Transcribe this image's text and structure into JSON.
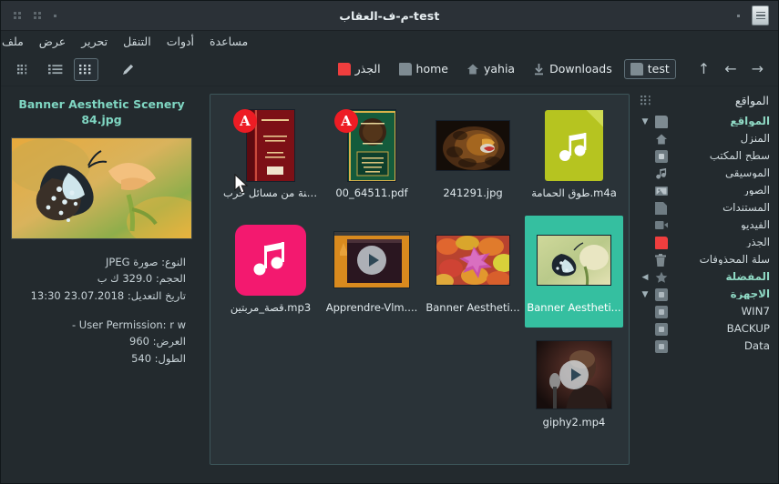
{
  "window": {
    "title": "م-ف-العقاب-test",
    "app_icon": "document-app-icon"
  },
  "menubar": {
    "items": [
      {
        "label": "ملف"
      },
      {
        "label": "عرض"
      },
      {
        "label": "تحرير"
      },
      {
        "label": "التنقل"
      },
      {
        "label": "أدوات"
      },
      {
        "label": "مساعدة"
      }
    ]
  },
  "toolbar": {
    "view_buttons": [
      {
        "name": "compact-view-button",
        "icon": "compact-view-icon"
      },
      {
        "name": "list-view-button",
        "icon": "list-view-icon"
      },
      {
        "name": "icon-view-button",
        "icon": "grid-view-icon",
        "active": true
      }
    ],
    "edit_button": {
      "name": "edit-button",
      "icon": "pencil-icon"
    },
    "nav": {
      "up": "↑",
      "back": "←",
      "forward": "→"
    },
    "breadcrumb": [
      {
        "label": "test",
        "icon": "folder-icon",
        "current": true
      },
      {
        "label": "Downloads",
        "icon": "download-icon",
        "current": false
      },
      {
        "label": "yahia",
        "icon": "home-icon",
        "current": false
      },
      {
        "label": "home",
        "icon": "folder-icon",
        "current": false
      },
      {
        "label": "الجذر",
        "icon": "root-folder-icon",
        "current": false
      }
    ]
  },
  "preview": {
    "title": "Banner Aesthetic Scenery 84.jpg",
    "thumbnail_alt": "butterfly-on-flower-photo",
    "metadata": [
      {
        "text": "النوع: صورة JPEG",
        "rtl": true
      },
      {
        "text": "الحجم: 329.0 ك ب",
        "rtl": true
      },
      {
        "text": "تاريخ التعديل: 23.07.2018 13:30",
        "rtl": true
      },
      {
        "text": "-  User Permission: r  w",
        "rtl": false
      },
      {
        "text": "العرض: 960",
        "rtl": true
      },
      {
        "text": "الطول: 540",
        "rtl": true
      }
    ]
  },
  "files": [
    {
      "label": "طوق الحمامة.m4a",
      "kind": "audio-document",
      "selected": false
    },
    {
      "label": "241291.jpg",
      "kind": "image-lion",
      "selected": false
    },
    {
      "label": "00_64511.pdf",
      "kind": "pdf-green-book",
      "selected": false
    },
    {
      "label": "السنة من مسائل حرب...",
      "kind": "pdf-red-book",
      "selected": false
    },
    {
      "label": "Banner Aestheti...",
      "kind": "image-butterfly",
      "selected": true
    },
    {
      "label": "Banner Aestheti...",
      "kind": "image-leaves",
      "selected": false
    },
    {
      "label": "Apprendre-Vlm....",
      "kind": "video-orange",
      "selected": false
    },
    {
      "label": "قصة_مربتين.mp3",
      "kind": "audio-pink",
      "selected": false
    },
    {
      "label": "giphy2.mp4",
      "kind": "video-person",
      "selected": false
    }
  ],
  "places": {
    "header": "المواقع",
    "items": [
      {
        "label": "المواقع",
        "icon": "folder-icon",
        "group": true,
        "arrow": "▼"
      },
      {
        "label": "المنزل",
        "icon": "home-icon",
        "group": false,
        "arrow": ""
      },
      {
        "label": "سطح المكتب",
        "icon": "desktop-icon",
        "group": false,
        "arrow": ""
      },
      {
        "label": "الموسيقى",
        "icon": "music-icon",
        "group": false,
        "arrow": ""
      },
      {
        "label": "الصور",
        "icon": "pictures-icon",
        "group": false,
        "arrow": ""
      },
      {
        "label": "المستندات",
        "icon": "documents-icon",
        "group": false,
        "arrow": ""
      },
      {
        "label": "الفيديو",
        "icon": "video-icon",
        "group": false,
        "arrow": ""
      },
      {
        "label": "الجذر",
        "icon": "root-folder-icon",
        "group": false,
        "arrow": ""
      },
      {
        "label": "سلة المحذوفات",
        "icon": "trash-icon",
        "group": false,
        "arrow": ""
      },
      {
        "label": "المفضلة",
        "icon": "star-icon",
        "group": true,
        "arrow": "◀"
      },
      {
        "label": "الاجهزة",
        "icon": "drive-icon",
        "group": true,
        "arrow": "▼"
      },
      {
        "label": "WIN7",
        "icon": "drive-icon",
        "group": false,
        "arrow": ""
      },
      {
        "label": "BACKUP",
        "icon": "drive-icon",
        "group": false,
        "arrow": ""
      },
      {
        "label": "Data",
        "icon": "drive-icon",
        "group": false,
        "arrow": ""
      }
    ]
  },
  "colors": {
    "window_bg": "#232a2e",
    "titlebar_bg": "#2b3137",
    "accent_teal": "#35bfa0",
    "preview_title": "#7fd6c2",
    "grid_bg": "#2a3338",
    "grid_border": "#3d565a",
    "pdf_red": "#ed1c24",
    "mp3_pink": "#f3196f",
    "m4a_olive": "#b6c420",
    "root_red": "#ef3e3e"
  }
}
